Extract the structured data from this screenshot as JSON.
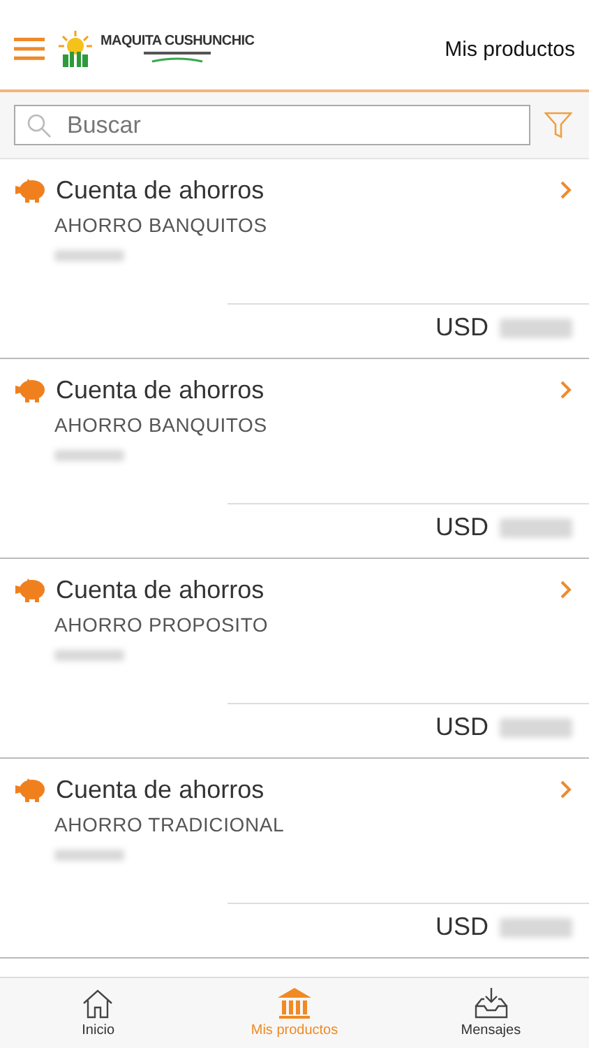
{
  "header": {
    "logo_text": "MAQUITA CUSHUNCHIC",
    "title": "Mis productos"
  },
  "search": {
    "placeholder": "Buscar"
  },
  "accounts": [
    {
      "type": "Cuenta de ahorros",
      "product": "AHORRO BANQUITOS",
      "currency": "USD"
    },
    {
      "type": "Cuenta de ahorros",
      "product": "AHORRO BANQUITOS",
      "currency": "USD"
    },
    {
      "type": "Cuenta de ahorros",
      "product": "AHORRO PROPOSITO",
      "currency": "USD"
    },
    {
      "type": "Cuenta de ahorros",
      "product": "AHORRO TRADICIONAL",
      "currency": "USD"
    }
  ],
  "tab_bar": [
    {
      "label": "Inicio",
      "selected": false
    },
    {
      "label": "Mis productos",
      "selected": true
    },
    {
      "label": "Mensajes",
      "selected": false
    }
  ]
}
